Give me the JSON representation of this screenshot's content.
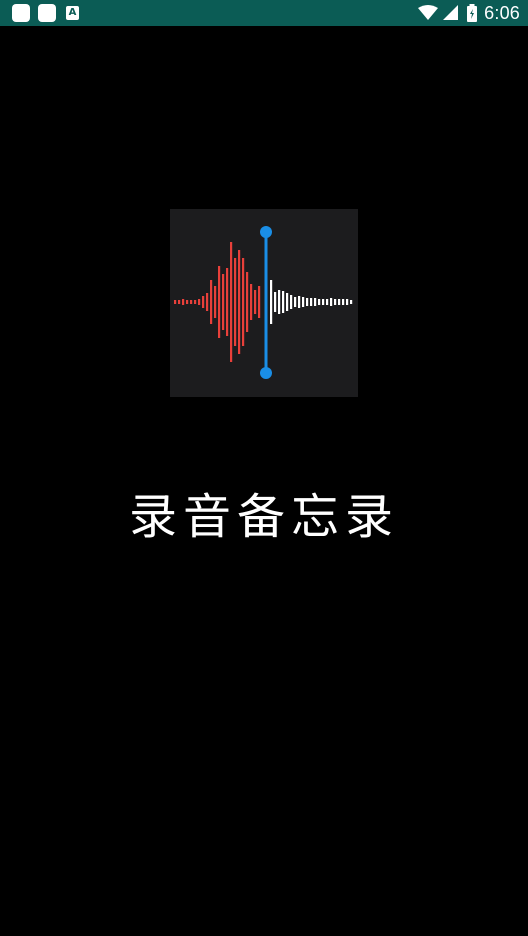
{
  "status_bar": {
    "time": "6:06",
    "a_icon_label": "A",
    "left_icons": [
      "notification-icon",
      "notification-icon",
      "a-badge-icon"
    ],
    "right_icons": [
      "wifi-icon",
      "cellular-signal-icon",
      "battery-icon"
    ]
  },
  "app": {
    "title": "录音备忘录",
    "icon": "voice-memos-waveform-icon",
    "colors": {
      "background": "#000000",
      "status_bar": "#0b5c55",
      "icon_background": "#1c1c1e",
      "waveform_recorded": "#e8403a",
      "waveform_pending": "#ffffff",
      "playhead": "#1a8ee6"
    }
  }
}
